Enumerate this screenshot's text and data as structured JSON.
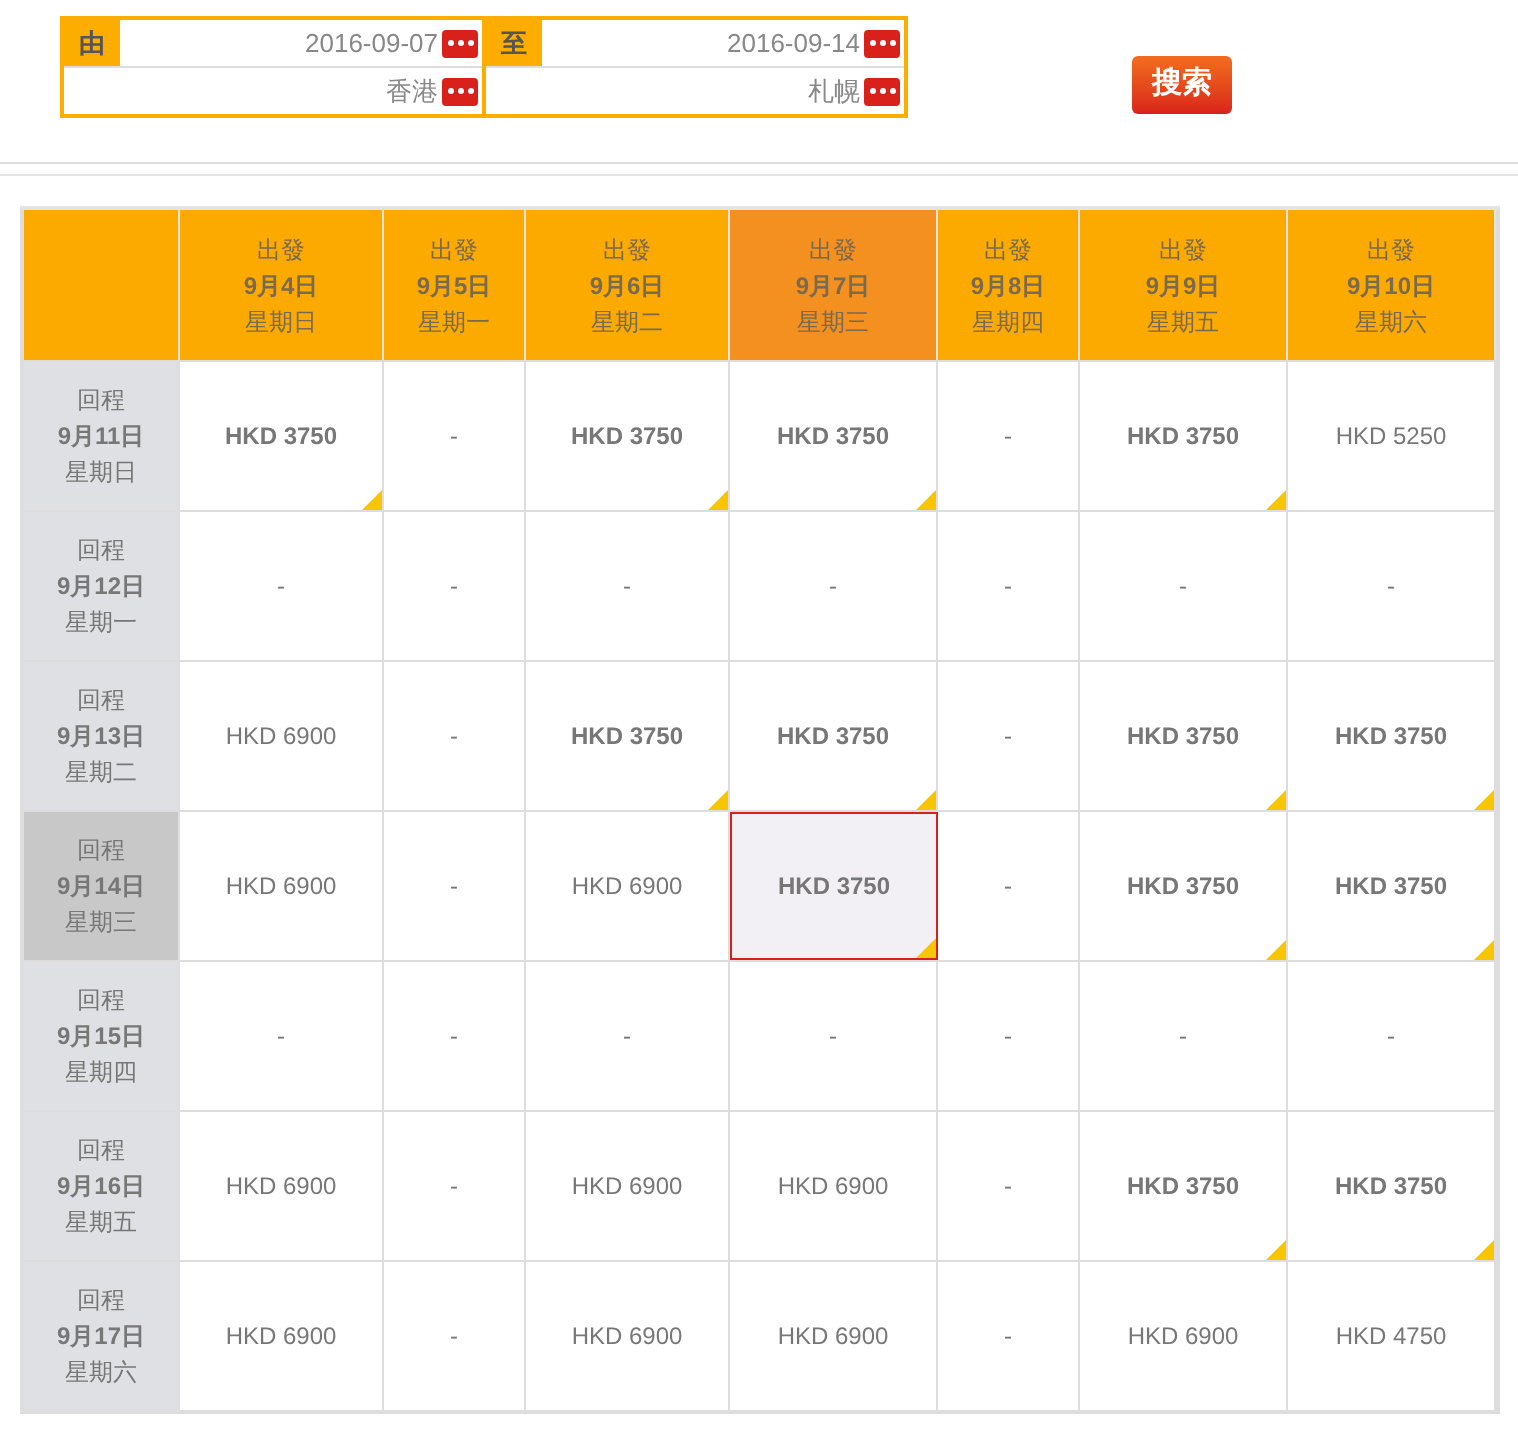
{
  "search_form": {
    "fields": [
      {
        "label": "由",
        "date": "2016-09-07",
        "place": "香港"
      },
      {
        "label": "至",
        "date": "2016-09-14",
        "place": "札幌"
      }
    ],
    "search_button": "搜索"
  },
  "table": {
    "columns": [
      {
        "line1": "出發",
        "line2": "9月4日",
        "line3": "星期日",
        "selected": false
      },
      {
        "line1": "出發",
        "line2": "9月5日",
        "line3": "星期一",
        "selected": false
      },
      {
        "line1": "出發",
        "line2": "9月6日",
        "line3": "星期二",
        "selected": false
      },
      {
        "line1": "出發",
        "line2": "9月7日",
        "line3": "星期三",
        "selected": true
      },
      {
        "line1": "出發",
        "line2": "9月8日",
        "line3": "星期四",
        "selected": false
      },
      {
        "line1": "出發",
        "line2": "9月9日",
        "line3": "星期五",
        "selected": false
      },
      {
        "line1": "出發",
        "line2": "9月10日",
        "line3": "星期六",
        "selected": false
      }
    ],
    "rows": [
      {
        "line1": "回程",
        "line2": "9月11日",
        "line3": "星期日",
        "selected": false,
        "cells": [
          {
            "text": "HKD 3750",
            "lowest": true,
            "selected": false
          },
          {
            "text": "-",
            "lowest": false,
            "selected": false
          },
          {
            "text": "HKD 3750",
            "lowest": true,
            "selected": false
          },
          {
            "text": "HKD 3750",
            "lowest": true,
            "selected": false
          },
          {
            "text": "-",
            "lowest": false,
            "selected": false
          },
          {
            "text": "HKD 3750",
            "lowest": true,
            "selected": false
          },
          {
            "text": "HKD 5250",
            "lowest": false,
            "selected": false
          }
        ]
      },
      {
        "line1": "回程",
        "line2": "9月12日",
        "line3": "星期一",
        "selected": false,
        "cells": [
          {
            "text": "-",
            "lowest": false,
            "selected": false
          },
          {
            "text": "-",
            "lowest": false,
            "selected": false
          },
          {
            "text": "-",
            "lowest": false,
            "selected": false
          },
          {
            "text": "-",
            "lowest": false,
            "selected": false
          },
          {
            "text": "-",
            "lowest": false,
            "selected": false
          },
          {
            "text": "-",
            "lowest": false,
            "selected": false
          },
          {
            "text": "-",
            "lowest": false,
            "selected": false
          }
        ]
      },
      {
        "line1": "回程",
        "line2": "9月13日",
        "line3": "星期二",
        "selected": false,
        "cells": [
          {
            "text": "HKD 6900",
            "lowest": false,
            "selected": false
          },
          {
            "text": "-",
            "lowest": false,
            "selected": false
          },
          {
            "text": "HKD 3750",
            "lowest": true,
            "selected": false
          },
          {
            "text": "HKD 3750",
            "lowest": true,
            "selected": false
          },
          {
            "text": "-",
            "lowest": false,
            "selected": false
          },
          {
            "text": "HKD 3750",
            "lowest": true,
            "selected": false
          },
          {
            "text": "HKD 3750",
            "lowest": true,
            "selected": false
          }
        ]
      },
      {
        "line1": "回程",
        "line2": "9月14日",
        "line3": "星期三",
        "selected": true,
        "cells": [
          {
            "text": "HKD 6900",
            "lowest": false,
            "selected": false
          },
          {
            "text": "-",
            "lowest": false,
            "selected": false
          },
          {
            "text": "HKD 6900",
            "lowest": false,
            "selected": false
          },
          {
            "text": "HKD 3750",
            "lowest": true,
            "selected": true
          },
          {
            "text": "-",
            "lowest": false,
            "selected": false
          },
          {
            "text": "HKD 3750",
            "lowest": true,
            "selected": false
          },
          {
            "text": "HKD 3750",
            "lowest": true,
            "selected": false
          }
        ]
      },
      {
        "line1": "回程",
        "line2": "9月15日",
        "line3": "星期四",
        "selected": false,
        "cells": [
          {
            "text": "-",
            "lowest": false,
            "selected": false
          },
          {
            "text": "-",
            "lowest": false,
            "selected": false
          },
          {
            "text": "-",
            "lowest": false,
            "selected": false
          },
          {
            "text": "-",
            "lowest": false,
            "selected": false
          },
          {
            "text": "-",
            "lowest": false,
            "selected": false
          },
          {
            "text": "-",
            "lowest": false,
            "selected": false
          },
          {
            "text": "-",
            "lowest": false,
            "selected": false
          }
        ]
      },
      {
        "line1": "回程",
        "line2": "9月16日",
        "line3": "星期五",
        "selected": false,
        "cells": [
          {
            "text": "HKD 6900",
            "lowest": false,
            "selected": false
          },
          {
            "text": "-",
            "lowest": false,
            "selected": false
          },
          {
            "text": "HKD 6900",
            "lowest": false,
            "selected": false
          },
          {
            "text": "HKD 6900",
            "lowest": false,
            "selected": false
          },
          {
            "text": "-",
            "lowest": false,
            "selected": false
          },
          {
            "text": "HKD 3750",
            "lowest": true,
            "selected": false
          },
          {
            "text": "HKD 3750",
            "lowest": true,
            "selected": false
          }
        ]
      },
      {
        "line1": "回程",
        "line2": "9月17日",
        "line3": "星期六",
        "selected": false,
        "cells": [
          {
            "text": "HKD 6900",
            "lowest": false,
            "selected": false
          },
          {
            "text": "-",
            "lowest": false,
            "selected": false
          },
          {
            "text": "HKD 6900",
            "lowest": false,
            "selected": false
          },
          {
            "text": "HKD 6900",
            "lowest": false,
            "selected": false
          },
          {
            "text": "-",
            "lowest": false,
            "selected": false
          },
          {
            "text": "HKD 6900",
            "lowest": false,
            "selected": false
          },
          {
            "text": "HKD 4750",
            "lowest": false,
            "selected": false
          }
        ]
      }
    ]
  }
}
